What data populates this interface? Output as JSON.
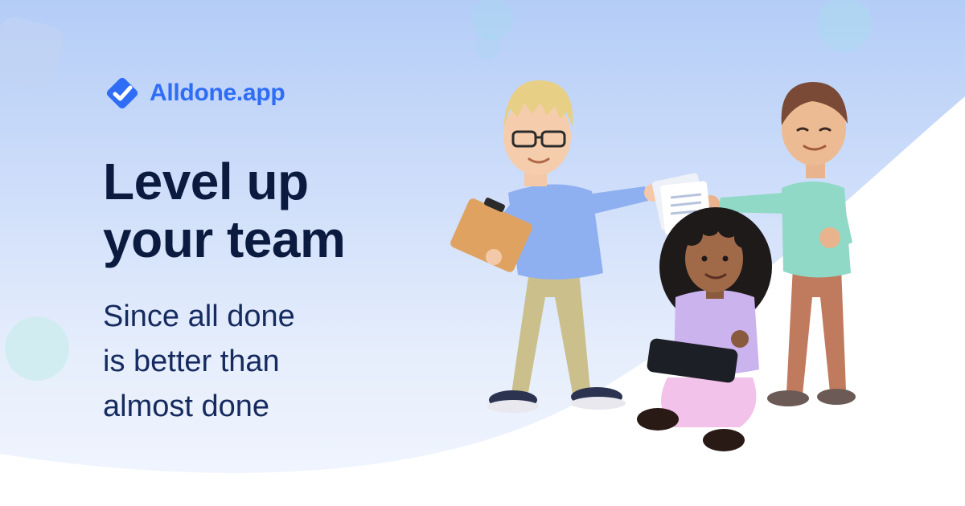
{
  "brand": {
    "name": "Alldone.app",
    "logo_icon": "diamond-check-icon",
    "color": "#2f6df6"
  },
  "hero": {
    "headline_lines": [
      "Level up",
      "your team"
    ],
    "subline_lines": [
      "Since all done",
      "is better than",
      "almost done"
    ],
    "headline_color": "#0b1a3f",
    "subline_color": "#152a5e"
  },
  "illustration": {
    "subject": "three-people-team-illustration",
    "figures": [
      "man-with-clipboard",
      "woman-with-tablet",
      "man-with-documents"
    ]
  },
  "colors": {
    "background_top": "#b4cdf7",
    "background_bottom": "#f2f6fe",
    "wave": "#ffffff"
  }
}
